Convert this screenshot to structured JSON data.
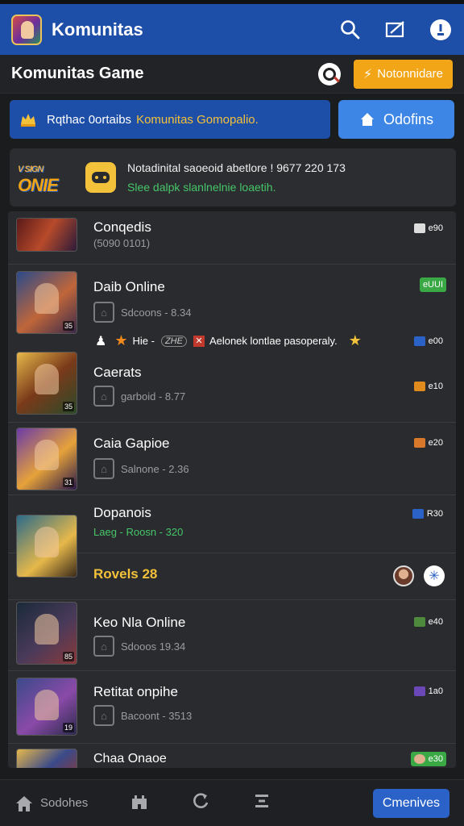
{
  "app": {
    "title": "Komunitas"
  },
  "section": {
    "title": "Komunitas Game",
    "notif_label": "Notonnidare"
  },
  "banner": {
    "text_white": "Rqthac 0ortaibs",
    "text_yellow": "Komunitas Gomopalio.",
    "options_label": "Odofins"
  },
  "promo": {
    "logo_small": "V SIGN",
    "logo_main": "ONIE",
    "line1": "Notadinital saoeoid abetlore ! 9677 220 173",
    "line2": "Slee dalpk slanlnelnie loaetih."
  },
  "games": [
    {
      "title": "Conqedis",
      "sub": "(5090 0101)",
      "tag": "e90",
      "tag_color": "#6a6b6f",
      "level": ""
    },
    {
      "title": "Daib Online",
      "sub": "Sdcoons - 8.34",
      "tag": "eUUI",
      "tag_color": "#3aa845",
      "level": "35"
    },
    {
      "title": "Caerats",
      "sub": "garboid - 8.77",
      "tag": "e10",
      "tag_color": "#e08b1e",
      "level": "35"
    },
    {
      "title": "Caia Gapioe",
      "sub": "Salnone - 2.36",
      "tag": "e20",
      "tag_color": "#d8782a",
      "level": "31"
    },
    {
      "title": "Dopanois",
      "sub": "Laeg - Roosn - 320",
      "tag": "R30",
      "tag_color": "#2a62c8",
      "level": ""
    },
    {
      "title": "Keo Nla Online",
      "sub": "Sdooos 19.34",
      "tag": "e40",
      "tag_color": "#4e8a3c",
      "level": "85"
    },
    {
      "title": "Retitat onpihe",
      "sub": "Bacoont - 3513",
      "tag": "1a0",
      "tag_color": "#6a48b8",
      "level": "19"
    },
    {
      "title": "Chaa Onaoe",
      "sub": "",
      "tag": "e30",
      "tag_color": "#3aa845",
      "level": ""
    }
  ],
  "interstitial1": {
    "name": "Hie -",
    "badge": "ZHE",
    "text": "Aelonek lontlae pasoperaly.",
    "tag": "e00"
  },
  "interstitial2": {
    "text": "Rovels 28"
  },
  "nav": {
    "home_label": "Sodohes",
    "communities_label": "Cmenives"
  }
}
